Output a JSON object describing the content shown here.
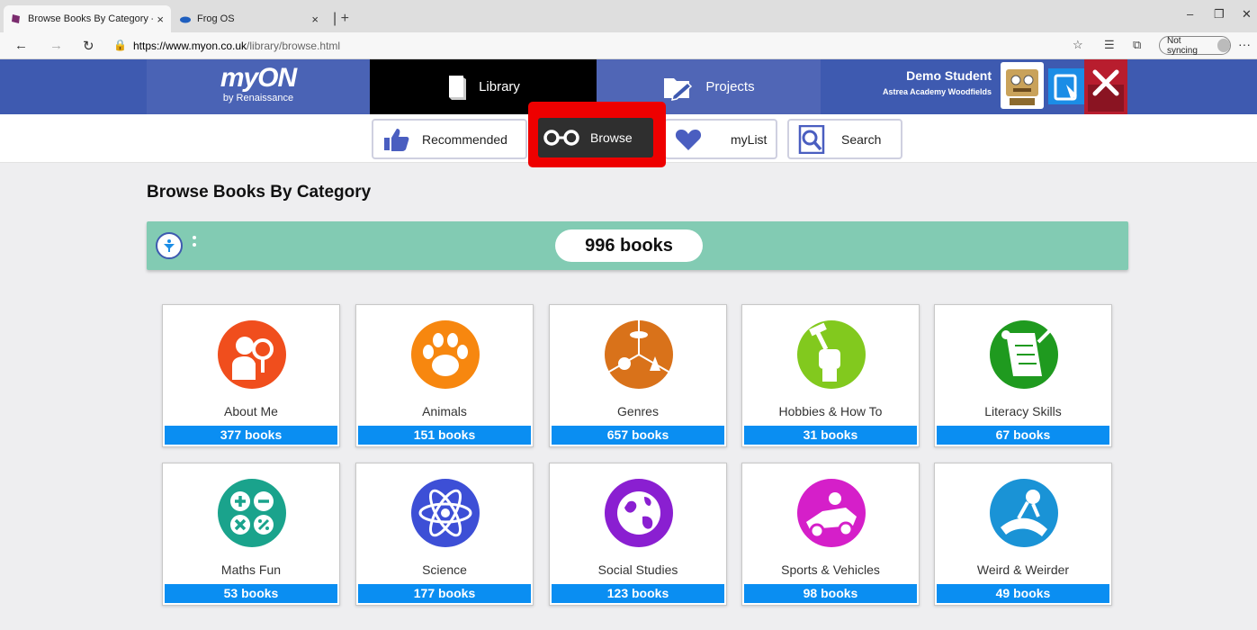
{
  "browser": {
    "tabs": [
      {
        "title": "Browse Books By Category - myO",
        "active": true
      },
      {
        "title": "Frog OS",
        "active": false
      }
    ],
    "url_host": "https://www.myon.co.uk",
    "url_path": "/library/browse.html",
    "sync_label": "Not syncing"
  },
  "header": {
    "logo": "myON",
    "logo_sub": "by Renaissance",
    "library_label": "Library",
    "projects_label": "Projects",
    "user_name": "Demo Student",
    "user_school": "Astrea Academy Woodfields"
  },
  "subnav": {
    "recommended": "Recommended",
    "browse": "Browse",
    "mylist": "myList",
    "search": "Search"
  },
  "page": {
    "heading": "Browse Books By Category",
    "total": "996 books"
  },
  "categories": [
    {
      "name": "About Me",
      "count": "377 books",
      "color": "#f04e1d"
    },
    {
      "name": "Animals",
      "count": "151 books",
      "color": "#f7870f"
    },
    {
      "name": "Genres",
      "count": "657 books",
      "color": "#d9721a"
    },
    {
      "name": "Hobbies & How To",
      "count": "31 books",
      "color": "#82c91e"
    },
    {
      "name": "Literacy Skills",
      "count": "67 books",
      "color": "#1f9a1f"
    },
    {
      "name": "Maths Fun",
      "count": "53 books",
      "color": "#1aa38c"
    },
    {
      "name": "Science",
      "count": "177 books",
      "color": "#3d4fd6"
    },
    {
      "name": "Social Studies",
      "count": "123 books",
      "color": "#8a1fd1"
    },
    {
      "name": "Sports & Vehicles",
      "count": "98 books",
      "color": "#d51fc9"
    },
    {
      "name": "Weird & Weirder",
      "count": "49 books",
      "color": "#1a93d6"
    }
  ],
  "colors": {
    "header": "#3e5ab0",
    "filterbar": "#82cbb3",
    "count_bar": "#0a8ef2",
    "highlight": "#ee0000"
  }
}
